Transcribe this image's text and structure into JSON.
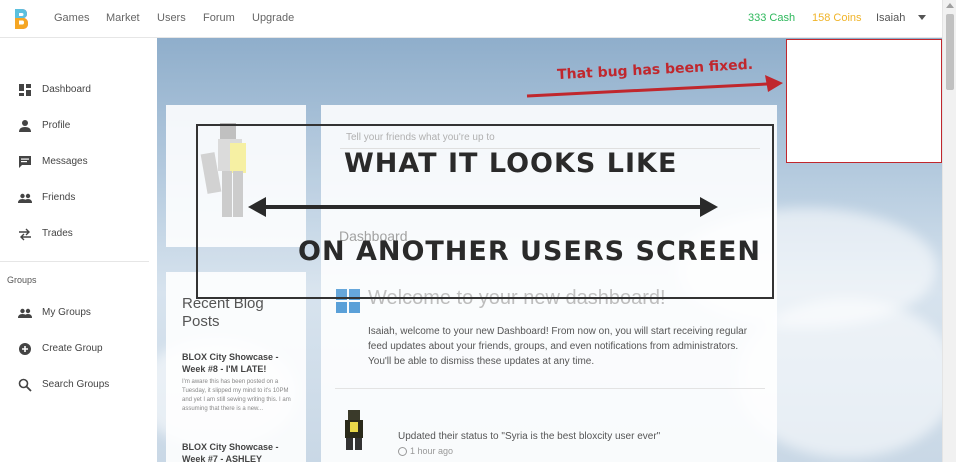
{
  "topbar": {
    "logo_letter": "B",
    "nav": [
      "Games",
      "Market",
      "Users",
      "Forum",
      "Upgrade"
    ],
    "cash": "333 Cash",
    "coins": "158 Coins",
    "username": "Isaiah"
  },
  "sidebar": {
    "items": [
      {
        "label": "Dashboard",
        "icon": "dashboard-icon"
      },
      {
        "label": "Profile",
        "icon": "person-icon"
      },
      {
        "label": "Messages",
        "icon": "message-icon"
      },
      {
        "label": "Friends",
        "icon": "people-icon"
      },
      {
        "label": "Trades",
        "icon": "swap-icon"
      }
    ],
    "groups_heading": "Groups",
    "group_items": [
      {
        "label": "My Groups",
        "icon": "people-icon"
      },
      {
        "label": "Create Group",
        "icon": "plus-circle-icon"
      },
      {
        "label": "Search Groups",
        "icon": "search-icon"
      }
    ]
  },
  "feed": {
    "placeholder": "Tell your friends what you're up to",
    "heading": "Dashboard",
    "welcome_title": "Welcome to your new dashboard!",
    "welcome_text": "Isaiah, welcome to your new Dashboard! From now on, you will start receiving regular feed updates about your friends, groups, and even notifications from administrators. You'll be able to dismiss these updates at any time.",
    "status": "Updated their status to \"Syria is the best bloxcity user ever\"",
    "status_time": "1 hour ago"
  },
  "blog": {
    "title": "Recent Blog Posts",
    "posts": [
      {
        "title": "BLOX City Showcase - Week #8 - I'M LATE!",
        "excerpt": "I'm aware this has been posted on a Tuesday, it slipped my mind to it's 10PM and yet I am still sewing writing this. I am assuming that there is a new..."
      },
      {
        "title": "BLOX City Showcase - Week #7 - ASHLEY"
      }
    ]
  },
  "annotations": {
    "overlay_line1": "WHAT IT LOOKS LIKE",
    "overlay_line2": "ON ANOTHER USERS SCREEN",
    "bug_note": "That bug has been fixed."
  },
  "colors": {
    "cash": "#2eb85c",
    "coins": "#f0b429",
    "annotation_red": "#c0272d"
  }
}
